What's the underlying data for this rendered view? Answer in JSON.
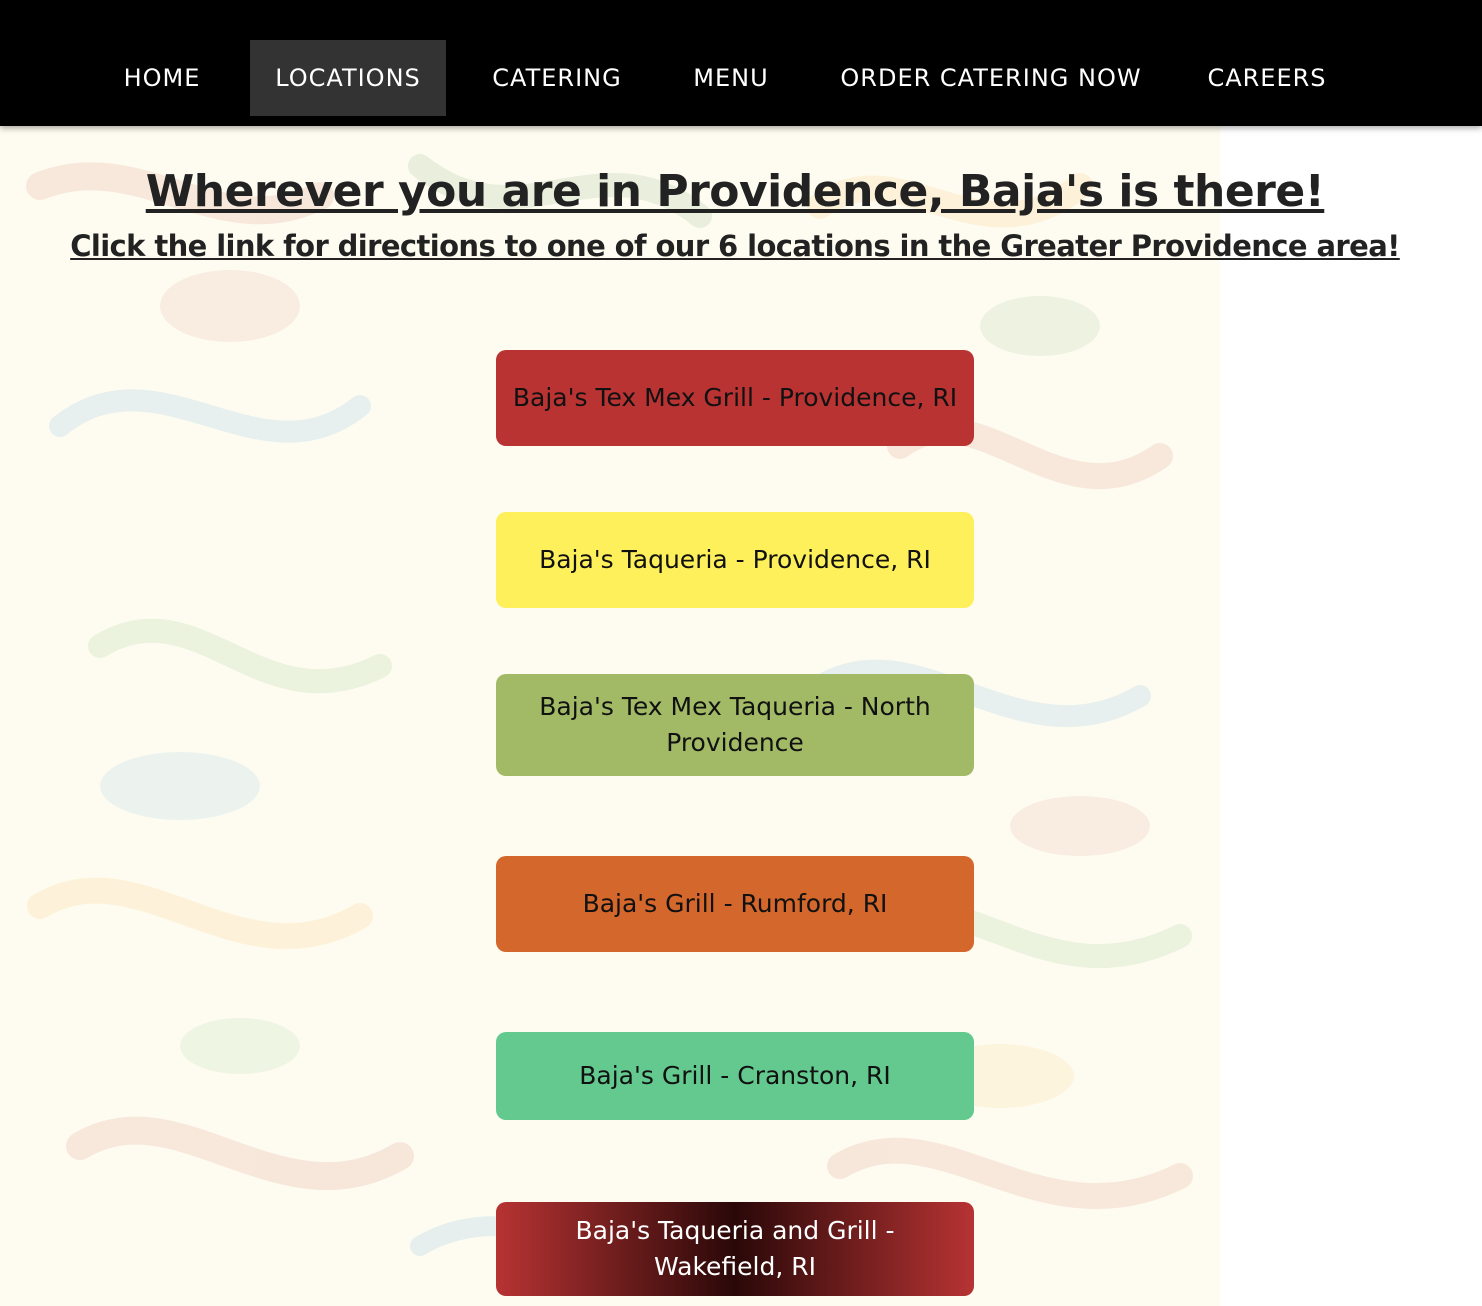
{
  "nav": {
    "items": [
      {
        "label": "HOME"
      },
      {
        "label": "LOCATIONS"
      },
      {
        "label": "CATERING"
      },
      {
        "label": "MENU"
      },
      {
        "label": "ORDER CATERING NOW"
      },
      {
        "label": "CAREERS"
      }
    ],
    "active_index": 1,
    "background": "#000000",
    "active_background": "#333333",
    "text_color": "#ffffff"
  },
  "main": {
    "headline": "Wherever you are in Providence, Baja's is there!",
    "subheadline": "Click the link for directions to one of our 6 locations in the Greater Providence area!",
    "locations": [
      {
        "label": "Baja's Tex Mex Grill - Providence, RI",
        "color": "#b93333"
      },
      {
        "label": "Baja's Taqueria - Providence, RI",
        "color": "#fef05a"
      },
      {
        "label": "Baja's Tex Mex Taqueria - North Providence",
        "color": "#a2ba66"
      },
      {
        "label": "Baja's Grill - Rumford, RI",
        "color": "#d4672c"
      },
      {
        "label": "Baja's Grill - Cranston, RI",
        "color": "#63c98f"
      },
      {
        "label": "Baja's Taqueria and Grill - Wakefield, RI",
        "color": "#b73333",
        "gradient_center": "#2a0808"
      }
    ]
  }
}
